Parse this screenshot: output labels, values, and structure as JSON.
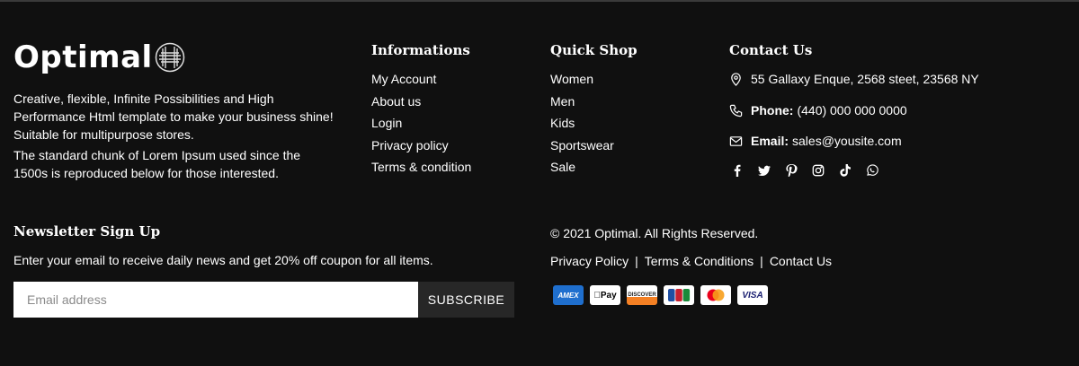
{
  "brand": {
    "name": "Optimal"
  },
  "about": {
    "p1": "Creative, flexible, Infinite Possibilities and High Performance Html template to make your business shine! Suitable for multipurpose stores.",
    "p2": "The standard chunk of Lorem Ipsum used since the 1500s is reproduced below for those interested."
  },
  "informations": {
    "title": "Informations",
    "items": [
      "My Account",
      "About us",
      "Login",
      "Privacy policy",
      "Terms & condition"
    ]
  },
  "quick_shop": {
    "title": "Quick Shop",
    "items": [
      "Women",
      "Men",
      "Kids",
      "Sportswear",
      "Sale"
    ]
  },
  "contact": {
    "title": "Contact Us",
    "address": "55 Gallaxy Enque, 2568 steet, 23568 NY",
    "phone_label": "Phone:",
    "phone": "(440) 000 000 0000",
    "email_label": "Email:",
    "email": "sales@yousite.com",
    "social_icons": [
      "facebook-icon",
      "twitter-icon",
      "pinterest-icon",
      "instagram-icon",
      "tiktok-icon",
      "whatsapp-icon"
    ]
  },
  "newsletter": {
    "title": "Newsletter Sign Up",
    "description": "Enter your email to receive daily news and get 20% off coupon for all items.",
    "placeholder": "Email address",
    "button": "SUBSCRIBE"
  },
  "bottom": {
    "copyright": "© 2021 Optimal. All Rights Reserved.",
    "links": [
      "Privacy Policy",
      "Terms & Conditions",
      "Contact Us"
    ],
    "separator": "|",
    "payments": [
      {
        "name": "amex-card-icon",
        "label": "AMEX",
        "bg": "#1f6fce",
        "fg": "#ffffff"
      },
      {
        "name": "apple-pay-card-icon",
        "label": "Pay",
        "bg": "#ffffff",
        "fg": "#000000"
      },
      {
        "name": "discover-card-icon",
        "label": "DISCOVER",
        "bg": "#ffffff",
        "fg": "#222222"
      },
      {
        "name": "jcb-card-icon",
        "label": "JCB",
        "bg": "#ffffff",
        "fg": "#1a6f3a"
      },
      {
        "name": "mastercard-card-icon",
        "label": "",
        "bg": "#ffffff",
        "fg": "#000000"
      },
      {
        "name": "visa-card-icon",
        "label": "VISA",
        "bg": "#ffffff",
        "fg": "#1a1f71"
      }
    ]
  },
  "colors": {
    "background": "#101010",
    "text": "#ffffff",
    "button_bg": "#272727"
  }
}
